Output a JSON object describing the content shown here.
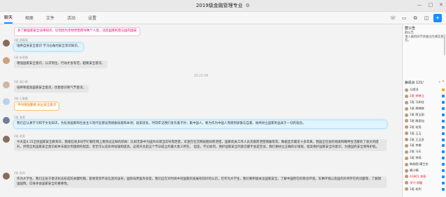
{
  "window": {
    "title": "2019级金融管理专业",
    "controls": [
      "—",
      "□",
      "✕"
    ]
  },
  "tabs": [
    {
      "label": "聊天",
      "active": true
    },
    {
      "label": "相册",
      "active": false
    },
    {
      "label": "文件",
      "active": false
    },
    {
      "label": "活动",
      "active": false
    },
    {
      "label": "设置",
      "active": false
    }
  ],
  "toolbar_icons": [
    "phone-icon",
    "video-icon",
    "screen-share-icon",
    "chat-icon",
    "add-icon"
  ],
  "messages": [
    {
      "sender": "",
      "text": "多了解国家安全法律知识，切勿因为贪财泄密而导致个人后，违反国家机密与国内国安",
      "style": "pink"
    },
    {
      "sender": "3班 胡萌萌",
      "text": "培养自身安全意识 学习必备的安全常识知识。",
      "style": "cyan"
    },
    {
      "sender": "1班 朱荣娜",
      "text": "增强国家安全意识，认识到位，行动才会有范，越要安全意识。",
      "style": "normal"
    },
    {
      "sender": "",
      "timestamp": "15:21:59"
    },
    {
      "sender": "2班 周小莉",
      "text": "培养和提高国家安全意识，优患意识和气节意识。",
      "style": "normal"
    },
    {
      "sender": "3班 王春霞",
      "text": "平时增强警惕 树立安全意识",
      "style": "orange"
    },
    {
      "sender": "1班 张萌",
      "text": "我们应认真学习和学文化知识，为投身国家和社会主义现代化建设而储备技能和本领；居安思危，时刻牢记我们身负着子孙；集中国人，要为作为中国人而感到骄傲与自豪，始终树立国家利益高于一切的观念。",
      "style": "cyan"
    },
    {
      "sender": "2班 毛亮",
      "text": "今天是4.15全民国家安全教育日，我相信很多同学们都在网上看到过这样的新闻：比如无意中为国外间谍当向导而泄密，军迷在社交网站晒训练泄密，国家机关工作人员贪腐而泄密情报等等，数据显示最近十多年来，我国全社会的地质和精神生活都有了很大的提升，然而全民国家安全意识却并未能达到理想的程度，甚至可以说有待加强和提高，这或许也是这个节日成立的最大意义所在。    但是，不论如何，保护国家安全的意识都不会是空谈，我们要树立正确的价值观，提高保护国家安全的意识，为祖国的安全保驾护航。",
      "style": "normal"
    },
    {
      "sender": "2班 毛利",
      "text": "作为大学生，我们正处于意识形态形成的关键时期，容易受到不良信息的误导，国际局势复杂多变，我们应在对时尚中对国家的发展有较好的认识，在作为大学生，我们要积极关注国家安全，了解中国所在的政治环境，军事环境以及国内外所存在的问题等，了解我国国情，切身体会国家安全的重要性。",
      "style": "normal"
    }
  ],
  "sidebar": {
    "notice_title": "群公告",
    "notice_text": "群公告\n请入群的同学改备注为真实姓名。",
    "members_title": "群成员 121/",
    "members": [
      {
        "name": "冯思洋",
        "color": "#333333",
        "badge": "#ffaa00"
      },
      {
        "name": "2班 李晓江",
        "color": "#e0202a",
        "badge": "#1a8cff"
      },
      {
        "name": "1班 马如佳",
        "color": "#333333",
        "badge": "#1a8cff"
      },
      {
        "name": "1班 胡晓晓",
        "color": "#333333",
        "badge": "#1a8cff"
      },
      {
        "name": "1班 周玉丽",
        "color": "#333333",
        "badge": "#1a8cff"
      },
      {
        "name": "1班 杨丽仙",
        "color": "#333333",
        "badge": "#1a8cff"
      },
      {
        "name": "2班 毛亮",
        "color": "#333333",
        "badge": "#1a8cff"
      },
      {
        "name": "1班 王玉",
        "color": "#333333",
        "badge": "#1a8cff"
      },
      {
        "name": "2班 王玉亚",
        "color": "#333333",
        "badge": "#1a8cff"
      },
      {
        "name": "1班 李娜",
        "color": "#333333",
        "badge": "#1a8cff"
      },
      {
        "name": "2班 马乐",
        "color": "#333333",
        "badge": "#1a8cff"
      },
      {
        "name": "1班 李萌",
        "color": "#333333",
        "badge": "#1a8cff"
      },
      {
        "name": "助助图-康兰花",
        "color": "#333333",
        "badge": "#1a8cff"
      },
      {
        "name": "蜗小蜗",
        "color": "#333333",
        "badge": "#1a8cff"
      },
      {
        "name": "A1801 李萌",
        "color": "#e0202a",
        "badge": "#1a8cff"
      },
      {
        "name": "学兴 邦霞",
        "color": "#e0202a",
        "badge": "#1a8cff"
      },
      {
        "name": "1班 毛利",
        "color": "#333333",
        "badge": "#1a8cff"
      }
    ]
  }
}
